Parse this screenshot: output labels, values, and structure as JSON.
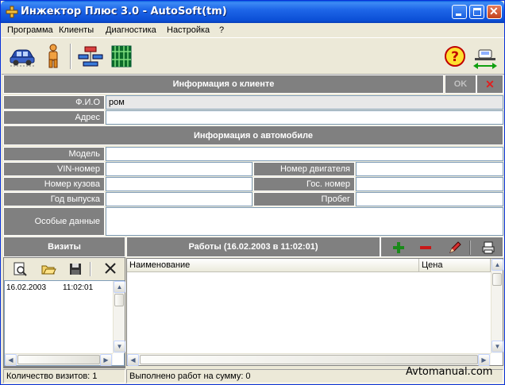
{
  "window": {
    "title": "Инжектор Плюс 3.0 - AutoSoft(tm)"
  },
  "menu": [
    "Программа",
    "Клиенты",
    "Диагностика",
    "Настройка",
    "?"
  ],
  "toolbar": {
    "icons": [
      "car-icon",
      "person-icon",
      "network-diagram-icon",
      "circuit-board-icon",
      "help-icon",
      "car-lift-icon"
    ]
  },
  "client": {
    "header": "Информация о клиенте",
    "ok_label": "OK",
    "cancel_label": "✕",
    "fio_label": "Ф.И.О",
    "fio_value": "ром",
    "address_label": "Адрес",
    "address_value": ""
  },
  "car": {
    "header": "Информация о автомобиле",
    "model_label": "Модель",
    "vin_label": "VIN-номер",
    "engine_label": "Номер двигателя",
    "body_label": "Номер кузова",
    "plate_label": "Гос. номер",
    "year_label": "Год выпуска",
    "mileage_label": "Пробег",
    "special_label": "Особые данные"
  },
  "visits": {
    "header": "Визиты",
    "rows": [
      {
        "date": "16.02.2003",
        "time": "11:02:01"
      }
    ],
    "status": "Количество визитов: 1"
  },
  "works": {
    "header": "Работы (16.02.2003 в 11:02:01)",
    "columns": [
      "Наименование",
      "Цена"
    ],
    "status": "Выполнено работ на сумму: 0"
  },
  "watermark": "Avtomanual.com",
  "colors": {
    "titlebar": "#0a5fe0",
    "panel_gray": "#808080",
    "window_bg": "#ece9d8",
    "add_green": "#1a8a1a",
    "remove_red": "#c81818"
  }
}
